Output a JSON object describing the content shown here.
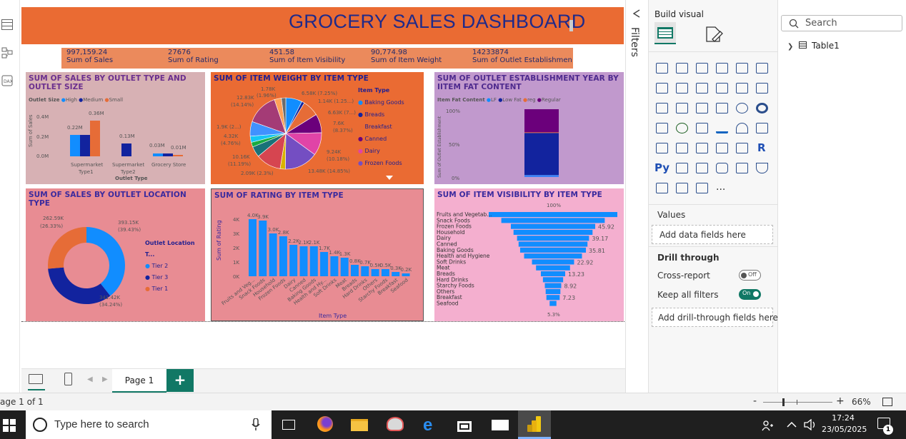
{
  "dashboard": {
    "title": "GROCERY SALES DASHBOARD"
  },
  "kpis": [
    {
      "value": "997,159.24",
      "label": "Sum of Sales"
    },
    {
      "value": "27676",
      "label": "Sum of Rating"
    },
    {
      "value": "451.58",
      "label": "Sum of Item Visibility"
    },
    {
      "value": "90,774.98",
      "label": "Sum of Item Weight"
    },
    {
      "value": "14233874",
      "label": "Sum of Outlet Establishment..."
    }
  ],
  "colors": {
    "header": "#ea6b33",
    "kpi": "#eb8a5c",
    "blue": "#118dff",
    "navy": "#12239e",
    "orange": "#e66c37",
    "purple": "#6b007b",
    "lfblue": "#3b82f6",
    "activeToggle": "#117865"
  },
  "chart_data": [
    {
      "type": "bar",
      "title": "SUM OF SALES BY OUTLET TYPE AND OUTLET SIZE",
      "legend_title": "Outlet Size",
      "xlabel": "Outlet Type",
      "ylabel": "Sum of Sales",
      "categories": [
        "Supermarket Type1",
        "Supermarket Type2",
        "Grocery Store"
      ],
      "y_ticks": [
        "0.4M",
        "0.2M",
        "0.0M"
      ],
      "ylim": [
        0,
        0.45
      ],
      "series": [
        {
          "name": "High",
          "values": [
            0.22,
            null,
            null
          ]
        },
        {
          "name": "Medium",
          "values": [
            0.22,
            0.13,
            0.03
          ]
        },
        {
          "name": "Small",
          "values": [
            0.36,
            null,
            0.01
          ]
        }
      ],
      "data_labels": [
        "0.22M",
        "0.36M",
        "0.13M",
        "0.03M",
        "0.01M"
      ]
    },
    {
      "type": "pie",
      "title": "SUM OF ITEM WEIGHT BY ITEM TYPE",
      "legend_title": "Item Type",
      "legend": [
        "Baking Goods",
        "Breads",
        "Breakfast",
        "Canned",
        "Dairy",
        "Frozen Foods"
      ],
      "slices": [
        {
          "label": "6.58K (7.25%)",
          "value": 6.58
        },
        {
          "label": "1.14K (1.25...)",
          "value": 1.14
        },
        {
          "label": "6.63K (7...)",
          "value": 6.63
        },
        {
          "label": "7.6K (8.37%)",
          "value": 7.6
        },
        {
          "label": "9.24K (10.18%)",
          "value": 9.24
        },
        {
          "label": "13.48K (14.85%)",
          "value": 13.48
        },
        {
          "label": "2.09K (2.3%)",
          "value": 2.09
        },
        {
          "label": "10.16K (11.19%)",
          "value": 10.16
        },
        {
          "label": "4.32K (4.76%)",
          "value": 4.32
        },
        {
          "label": "1.9K (2...)",
          "value": 1.9
        },
        {
          "label": "",
          "value": 2.5
        },
        {
          "label": "",
          "value": 5.9
        },
        {
          "label": "12.83K (14.14%)",
          "value": 12.83
        },
        {
          "label": "",
          "value": 2.8
        },
        {
          "label": "1.78K (1.96%)",
          "value": 1.78
        }
      ]
    },
    {
      "type": "bar",
      "title": "SUM OF OUTLET ESTABLISHMENT YEAR BY IITEM FAT CONTENT",
      "legend_title": "Item Fat Content",
      "legend": [
        "LF",
        "Low Fat",
        "reg",
        "Regular"
      ],
      "ylabel": "Sum of Outlet Establishment",
      "y_ticks": [
        "100%",
        "50%",
        "0%"
      ],
      "ylim": [
        0,
        100
      ],
      "series": [
        {
          "name": "LF",
          "values": [
            3
          ]
        },
        {
          "name": "Low Fat",
          "values": [
            62
          ]
        },
        {
          "name": "reg",
          "values": [
            1
          ]
        },
        {
          "name": "Regular",
          "values": [
            34
          ]
        }
      ]
    },
    {
      "type": "pie",
      "title": "SUM OF SALES BY OUTLET LOCATION TYPE",
      "legend_title": "Outlet Location T...",
      "legend": [
        "Tier 2",
        "Tier 3",
        "Tier 1"
      ],
      "slices": [
        {
          "name": "Tier 2",
          "value": 393.15,
          "label": "393.15K",
          "pct": "(39.43%)"
        },
        {
          "name": "Tier 3",
          "value": 341.42,
          "label": "341.42K",
          "pct": "(34.24%)"
        },
        {
          "name": "Tier 1",
          "value": 262.59,
          "label": "262.59K",
          "pct": "(26.33%)"
        }
      ]
    },
    {
      "type": "bar",
      "title": "SUM OF RATING BY ITEM TYPE",
      "xlabel": "Item Type",
      "ylabel": "Sum of Rating",
      "y_ticks": [
        "4K",
        "3K",
        "2K",
        "1K",
        "0K"
      ],
      "ylim": [
        0,
        4.3
      ],
      "categories": [
        "Fruits and Veg...",
        "Snack Foods",
        "Household",
        "Frozen Foods",
        "Dairy",
        "Canned",
        "Baking Goods",
        "Health and Hy...",
        "Soft Drinks",
        "Meat",
        "Breads",
        "Hard Drinks",
        "Others",
        "Starchy Foods",
        "Breakfast",
        "Seafood"
      ],
      "values": [
        4.0,
        3.9,
        3.0,
        2.8,
        2.2,
        2.1,
        2.1,
        1.7,
        1.4,
        1.3,
        0.8,
        0.7,
        0.5,
        0.5,
        0.3,
        0.2
      ],
      "data_labels": [
        "4.0K",
        "3.9K",
        "3.0K",
        "2.8K",
        "2.2K",
        "2.1K",
        "2.1K",
        "1.7K",
        "1.4K",
        "1.3K",
        "0.8K",
        "0.7K",
        "0.5K",
        "0.5K",
        "0.3K",
        "0.2K"
      ]
    },
    {
      "type": "bar",
      "title": "SUM OF ITEM VISIBILITY BY ITEM TYPE",
      "top_label": "100%",
      "bottom_label": "5.3%",
      "categories": [
        "Fruits and Vegetab...",
        "Snack Foods",
        "Frozen Foods",
        "Household",
        "Dairy",
        "Canned",
        "Baking Goods",
        "Health and Hygiene",
        "Soft Drinks",
        "Meat",
        "Breads",
        "Hard Drinks",
        "Starchy Foods",
        "Others",
        "Breakfast",
        "Seafood"
      ],
      "values": [
        70.0,
        56.3,
        45.92,
        43.0,
        39.17,
        37.5,
        35.81,
        31.5,
        22.92,
        18.5,
        13.23,
        11.0,
        8.92,
        8.0,
        7.23,
        3.7
      ],
      "data_labels": [
        "",
        "",
        "45.92",
        "",
        "39.17",
        "",
        "35.81",
        "",
        "22.92",
        "",
        "13.23",
        "",
        "8.92",
        "",
        "7.23",
        ""
      ]
    }
  ],
  "canvas": {
    "page_tab": "Page 1",
    "add_page": "+",
    "status_left": "age 1 of 1",
    "zoom": "66%",
    "zoom_minus": "-",
    "zoom_plus": "+"
  },
  "filters": {
    "label": "Filters"
  },
  "viz_pane": {
    "title": "Build visual",
    "values_label": "Values",
    "values_placeholder": "Add data fields here",
    "drill_through": "Drill through",
    "cross_report": "Cross-report",
    "cross_report_state": "Off",
    "keep_filters": "Keep all filters",
    "keep_filters_state": "On",
    "drill_placeholder": "Add drill-through fields here",
    "r_glyph": "R",
    "py_glyph": "Py",
    "more": "..."
  },
  "data_pane": {
    "search_placeholder": "Search",
    "table": "Table1"
  },
  "taskbar": {
    "search_text": "Type here to search",
    "time": "17:24",
    "date": "23/05/2025",
    "notif_count": "1"
  }
}
